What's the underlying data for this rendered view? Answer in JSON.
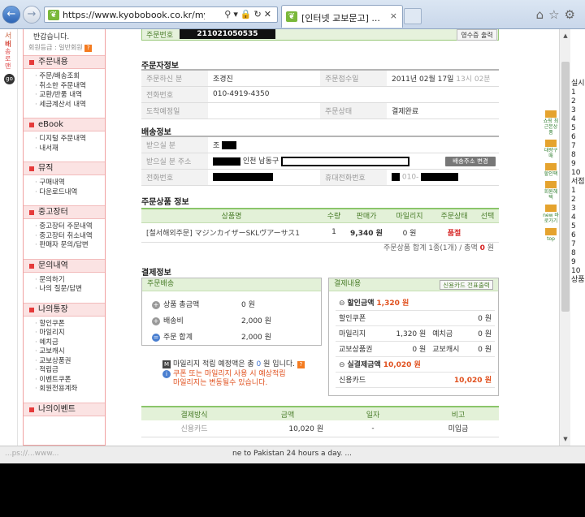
{
  "browser": {
    "url": "https://www.kyobobook.co.kr/myroo",
    "tab_title": "[인터넷 교보문고] ...",
    "tab_close": "×",
    "back_glyph": "←",
    "forward_glyph": "→",
    "addr_tools": "⚲▾🔒↻✕",
    "home_glyph": "⌂",
    "star_glyph": "☆",
    "gear_glyph": "⚙"
  },
  "service_strip": {
    "label1": "서비",
    "label2": "배송로맨",
    "go": "go"
  },
  "sidebar": {
    "greeting": "반갑습니다.",
    "grade": "회원등급 : 일반회원",
    "grade_q": "?",
    "sections": [
      {
        "title": "주문내용",
        "items": [
          "주문/배송조회",
          "취소한 주문내역",
          "교환/반품 내역",
          "세금계산서 내역"
        ]
      },
      {
        "title": "eBook",
        "items": [
          "디지털 주문내역",
          "내서재"
        ]
      },
      {
        "title": "뮤직",
        "items": [
          "구매내역",
          "다운로드내역"
        ]
      },
      {
        "title": "중고장터",
        "items": [
          "중고장터 주문내역",
          "중고장터 취소내역",
          "판매자 문의/답변"
        ]
      },
      {
        "title": "문의내역",
        "items": [
          "문의하기",
          "나의 질문/답변"
        ]
      },
      {
        "title": "나의통장",
        "items": [
          "할인쿠폰",
          "마일리지",
          "예치금",
          "교보캐시",
          "교보상품권",
          "적립금",
          "이벤트쿠폰",
          "회원전용계좌"
        ]
      },
      {
        "title": "나의이벤트",
        "items": []
      }
    ]
  },
  "order": {
    "number_label": "주문번호",
    "number": "211021050535",
    "receipt_button": "영수증 출력"
  },
  "orderer": {
    "heading": "주문자정보",
    "rows": [
      {
        "k1": "주문하신 분",
        "v1": "조경진",
        "k2": "주문접수일",
        "v2": "2011년 02월 17일",
        "v2b": "13시 02분"
      },
      {
        "k1": "전화번호",
        "v1": "010-4919-4350",
        "k2": "",
        "v2": "",
        "v2b": ""
      },
      {
        "k1": "도착예정일",
        "v1": "",
        "k2": "주문상태",
        "v2": "결제완료",
        "v2b": ""
      }
    ]
  },
  "delivery": {
    "heading": "배송정보",
    "receiver_label": "받으실 분",
    "receiver": "조",
    "address_label": "받으실 분 주소",
    "address": "인천 남동구",
    "address_button": "배송주소 변경",
    "phone_label": "전화번호",
    "mobile_label": "휴대전화번호",
    "mobile_prefix": "010-"
  },
  "products": {
    "heading": "주문상품 정보",
    "columns": [
      "상품명",
      "수량",
      "판매가",
      "마일리지",
      "주문상태",
      "선택"
    ],
    "rows": [
      {
        "name": "[철서해외주문] マジンカイザーSKLヴアーサス1",
        "qty": "1",
        "price": "9,340 원",
        "mileage": "0 원",
        "status": "품절",
        "select": ""
      }
    ],
    "summary_prefix": "주문상품 합계 1종(1개) / 총액",
    "summary_amount": "0",
    "summary_unit": "원"
  },
  "payment": {
    "heading": "결제정보",
    "ship_box_title": "주문배송",
    "ship_rows": [
      {
        "icon": "+",
        "label": "상품 총금액",
        "amount": "0 원"
      },
      {
        "icon": "+",
        "label": "배송비",
        "amount": "2,000 원"
      },
      {
        "icon": "=",
        "label": "주문 합계",
        "amount": "2,000 원"
      }
    ],
    "pay_box_title": "결제내용",
    "card_button": "신용카드 전표출력",
    "discount_label": "할인금액",
    "discount_amount": "1,320 원",
    "pay_rows": [
      {
        "k1": "할인쿠폰",
        "v1": "0 원",
        "k2": "",
        "v2": ""
      },
      {
        "k1": "마일리지",
        "v1": "1,320 원",
        "k2": "예치금",
        "v2": "0 원"
      },
      {
        "k1": "교보상품권",
        "v1": "0 원",
        "k2": "교보캐시",
        "v2": "0 원"
      }
    ],
    "actual_label": "실결제금액",
    "actual_amount": "10,020 원",
    "card_label": "신용카드",
    "card_amount": "10,020 원",
    "mileage_note_prefix": "마일리지 적립 예정액은 총",
    "mileage_note_amount": "0",
    "mileage_note_suffix": "원 입니다.",
    "warn1": "쿠폰 또는 마일리지 사용 시 예상적립",
    "warn2": "마일리지는 변동될수 있습니다."
  },
  "method": {
    "columns": [
      "결제방식",
      "금액",
      "일자",
      "비고"
    ],
    "rows": [
      {
        "type": "신용카드",
        "amount": "10,020 원",
        "date": "-",
        "note": "미입금"
      }
    ]
  },
  "side_widgets": [
    "쇼핑 최근본상품",
    "대량구매",
    "할인팩",
    "회원혜택",
    "new 바로가기",
    "top"
  ],
  "right_col_text": [
    "실시",
    "1",
    "2",
    "3",
    "4",
    "5",
    "6",
    "7",
    "8",
    "9",
    "10",
    "서점",
    "1",
    "2",
    "3",
    "4",
    "5",
    "6",
    "7",
    "8",
    "9",
    "10",
    "상품"
  ],
  "bottom": {
    "left": "...ps://...www...",
    "right": "ne to Pakistan 24 hours a day. ..."
  }
}
